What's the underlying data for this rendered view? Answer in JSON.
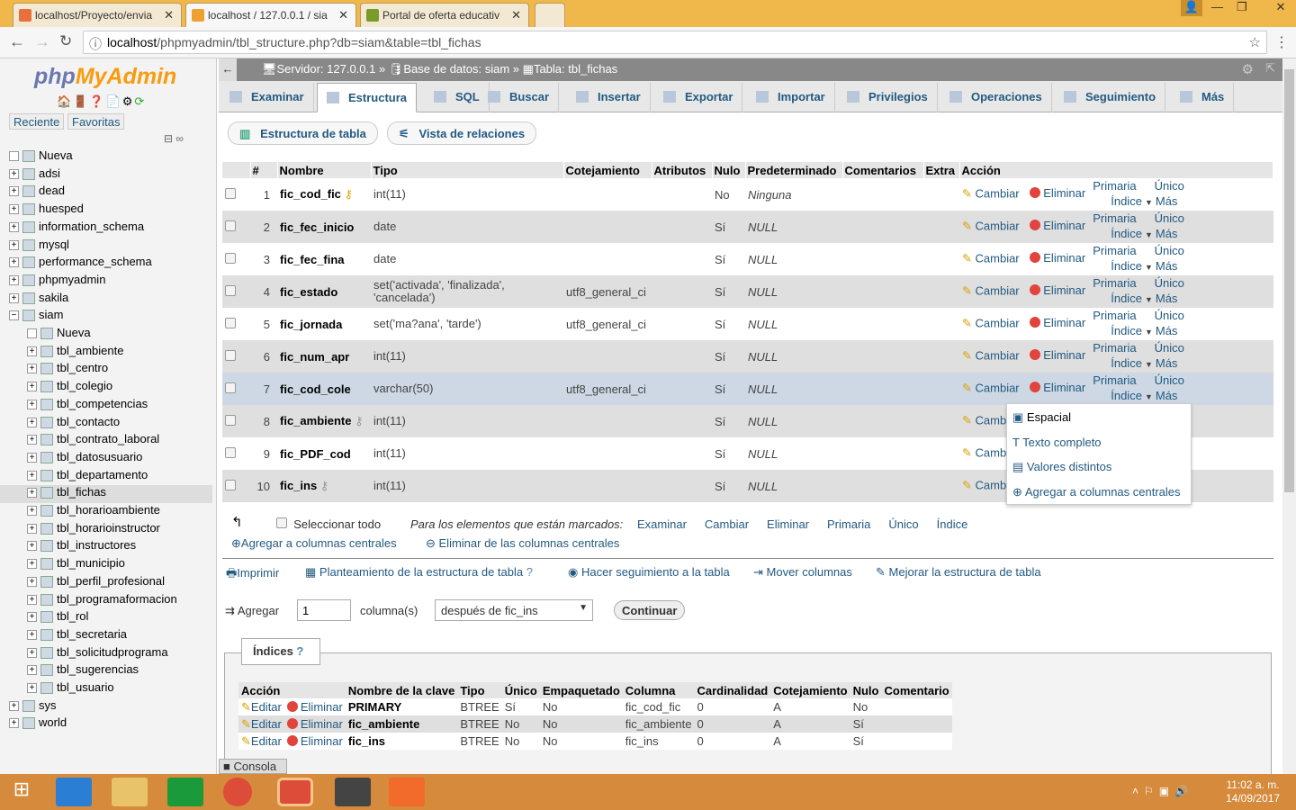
{
  "browser": {
    "tabs": [
      {
        "title": "localhost/Proyecto/envia",
        "fav": "xampp-icon"
      },
      {
        "title": "localhost / 127.0.0.1 / sia",
        "fav": "pma-icon"
      },
      {
        "title": "Portal de oferta educativ",
        "fav": "sp-icon"
      }
    ],
    "url_host": "localhost",
    "url_path": "/phpmyadmin/tbl_structure.php?db=siam&table=tbl_fichas"
  },
  "sidebar": {
    "logo_php": "php",
    "logo_rest": "MyAdmin",
    "recent": "Reciente",
    "favorites": "Favoritas",
    "dbs": [
      "Nueva",
      "adsi",
      "dead",
      "huesped",
      "information_schema",
      "mysql",
      "performance_schema",
      "phpmyadmin",
      "sakila",
      "siam"
    ],
    "siam_children": [
      "Nueva",
      "tbl_ambiente",
      "tbl_centro",
      "tbl_colegio",
      "tbl_competencias",
      "tbl_contacto",
      "tbl_contrato_laboral",
      "tbl_datosusuario",
      "tbl_departamento",
      "tbl_fichas",
      "tbl_horarioambiente",
      "tbl_horarioinstructor",
      "tbl_instructores",
      "tbl_municipio",
      "tbl_perfil_profesional",
      "tbl_programaformacion",
      "tbl_rol",
      "tbl_secretaria",
      "tbl_solicitudprograma",
      "tbl_sugerencias",
      "tbl_usuario"
    ],
    "after": [
      "sys",
      "world"
    ],
    "selected": "tbl_fichas"
  },
  "breadcrumb": {
    "server": "Servidor: 127.0.0.1",
    "db": "Base de datos: siam",
    "table": "Tabla: tbl_fichas",
    "sep": "»"
  },
  "tabs": [
    "Examinar",
    "Estructura",
    "SQL",
    "Buscar",
    "Insertar",
    "Exportar",
    "Importar",
    "Privilegios",
    "Operaciones",
    "Seguimiento",
    "Más"
  ],
  "active_tab": "Estructura",
  "subtabs": [
    "Estructura de tabla",
    "Vista de relaciones"
  ],
  "structure": {
    "headers": [
      "#",
      "Nombre",
      "Tipo",
      "Cotejamiento",
      "Atributos",
      "Nulo",
      "Predeterminado",
      "Comentarios",
      "Extra",
      "Acción"
    ],
    "rows": [
      {
        "n": "1",
        "name": "fic_cod_fic",
        "key": "primary",
        "type": "int(11)",
        "coll": "",
        "null": "No",
        "def": "Ninguna"
      },
      {
        "n": "2",
        "name": "fic_fec_inicio",
        "key": "",
        "type": "date",
        "coll": "",
        "null": "Sí",
        "def": "NULL"
      },
      {
        "n": "3",
        "name": "fic_fec_fina",
        "key": "",
        "type": "date",
        "coll": "",
        "null": "Sí",
        "def": "NULL"
      },
      {
        "n": "4",
        "name": "fic_estado",
        "key": "",
        "type": "set('activada', 'finalizada', 'cancelada')",
        "coll": "utf8_general_ci",
        "null": "Sí",
        "def": "NULL"
      },
      {
        "n": "5",
        "name": "fic_jornada",
        "key": "",
        "type": "set('ma?ana', 'tarde')",
        "coll": "utf8_general_ci",
        "null": "Sí",
        "def": "NULL"
      },
      {
        "n": "6",
        "name": "fic_num_apr",
        "key": "",
        "type": "int(11)",
        "coll": "",
        "null": "Sí",
        "def": "NULL"
      },
      {
        "n": "7",
        "name": "fic_cod_cole",
        "key": "",
        "type": "varchar(50)",
        "coll": "utf8_general_ci",
        "null": "Sí",
        "def": "NULL"
      },
      {
        "n": "8",
        "name": "fic_ambiente",
        "key": "index",
        "type": "int(11)",
        "coll": "",
        "null": "Sí",
        "def": "NULL"
      },
      {
        "n": "9",
        "name": "fic_PDF_cod",
        "key": "",
        "type": "int(11)",
        "coll": "",
        "null": "Sí",
        "def": "NULL"
      },
      {
        "n": "10",
        "name": "fic_ins",
        "key": "index",
        "type": "int(11)",
        "coll": "",
        "null": "Sí",
        "def": "NULL"
      }
    ],
    "actions": {
      "change": "Cambiar",
      "drop": "Eliminar",
      "primary": "Primaria",
      "unique": "Único",
      "index": "Índice",
      "more": "Más"
    }
  },
  "more_menu": [
    "Espacial",
    "Texto completo",
    "Valores distintos",
    "Agregar a columnas centrales"
  ],
  "bulk": {
    "select_all": "Seleccionar todo",
    "marked": "Para los elementos que están marcados:",
    "items": [
      "Examinar",
      "Cambiar",
      "Eliminar",
      "Primaria",
      "Único",
      "Índice"
    ],
    "central_add": "Agregar a columnas centrales",
    "central_remove": "Eliminar de las columnas centrales"
  },
  "tools": [
    "Imprimir",
    "Planteamiento de la estructura de tabla",
    "Hacer seguimiento a la tabla",
    "Mover columnas",
    "Mejorar la estructura de tabla"
  ],
  "add": {
    "label": "Agregar",
    "count": "1",
    "unit": "columna(s)",
    "position": "después de fic_ins",
    "continue": "Continuar"
  },
  "indexes": {
    "title": "Índices",
    "headers": [
      "Acción",
      "Nombre de la clave",
      "Tipo",
      "Único",
      "Empaquetado",
      "Columna",
      "Cardinalidad",
      "Cotejamiento",
      "Nulo",
      "Comentario"
    ],
    "edit": "Editar",
    "drop": "Eliminar",
    "rows": [
      [
        "PRIMARY",
        "BTREE",
        "Sí",
        "No",
        "fic_cod_fic",
        "0",
        "A",
        "No",
        ""
      ],
      [
        "fic_ambiente",
        "BTREE",
        "No",
        "No",
        "fic_ambiente",
        "0",
        "A",
        "Sí",
        ""
      ],
      [
        "fic_ins",
        "BTREE",
        "No",
        "No",
        "fic_ins",
        "0",
        "A",
        "Sí",
        ""
      ]
    ]
  },
  "console": "Consola",
  "clock": {
    "time": "11:02 a. m.",
    "date": "14/09/2017"
  }
}
